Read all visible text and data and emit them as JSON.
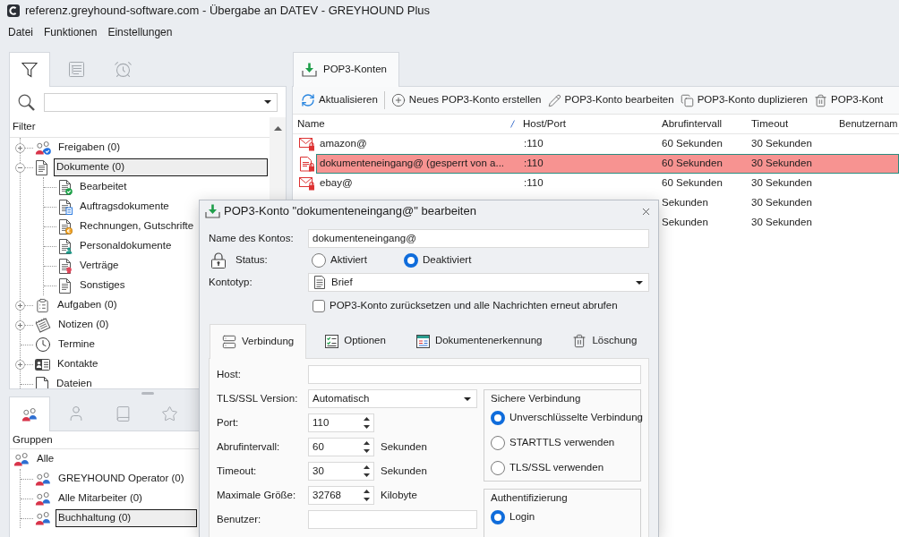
{
  "window": {
    "title": "referenz.greyhound-software.com - Übergabe an DATEV - GREYHOUND Plus"
  },
  "menu": [
    {
      "label": "Datei"
    },
    {
      "label": "Funktionen"
    },
    {
      "label": "Einstellungen"
    }
  ],
  "filter_panel": {
    "tabs": [
      {
        "selected": true
      },
      {
        "selected": false
      },
      {
        "selected": false
      }
    ],
    "header": "Filter",
    "tree": [
      {
        "label": "Freigaben (0)",
        "expandable": true,
        "expanded": false,
        "selected": false
      },
      {
        "label": "Dokumente (0)",
        "expandable": true,
        "expanded": true,
        "selected": true,
        "children": [
          {
            "label": "Bearbeitet",
            "selected": false
          },
          {
            "label": "Auftragsdokumente",
            "selected": false
          },
          {
            "label": "Rechnungen, Gutschrifte",
            "selected": false
          },
          {
            "label": "Personaldokumente",
            "selected": false
          },
          {
            "label": "Verträge",
            "selected": false
          },
          {
            "label": "Sonstiges",
            "selected": false
          }
        ]
      },
      {
        "label": "Aufgaben (0)",
        "expandable": true,
        "expanded": false,
        "selected": false
      },
      {
        "label": "Notizen (0)",
        "expandable": true,
        "expanded": false,
        "selected": false
      },
      {
        "label": "Termine",
        "expandable": false,
        "selected": false
      },
      {
        "label": "Kontakte",
        "expandable": true,
        "expanded": false,
        "selected": false
      },
      {
        "label": "Dateien",
        "expandable": false,
        "selected": false
      }
    ]
  },
  "groups_panel": {
    "tabs": [
      {
        "selected": true
      },
      {
        "selected": false
      },
      {
        "selected": false
      },
      {
        "selected": false
      }
    ],
    "header": "Gruppen",
    "tree": [
      {
        "label": "Alle",
        "selected": false,
        "children": [
          {
            "label": "GREYHOUND Operator (0)",
            "selected": false
          },
          {
            "label": "Alle Mitarbeiter (0)",
            "selected": false
          },
          {
            "label": "Buchhaltung (0)",
            "selected": true
          }
        ]
      }
    ]
  },
  "accounts": {
    "tabs": [
      {
        "label": "POP3-Konten",
        "selected": true
      }
    ],
    "toolbar": [
      {
        "label": "Aktualisieren"
      },
      {
        "label": "Neues POP3-Konto erstellen"
      },
      {
        "label": "POP3-Konto bearbeiten"
      },
      {
        "label": "POP3-Konto duplizieren"
      },
      {
        "label": "POP3-Kont"
      }
    ],
    "table": {
      "columns": [
        "Name",
        "Host/Port",
        "Abrufintervall",
        "Timeout",
        "Benutzernam"
      ],
      "rows": [
        {
          "kind": "mail",
          "name": "amazon@",
          "host_port": ":110",
          "interval": "60 Sekunden",
          "timeout": "30 Sekunden",
          "selected": false
        },
        {
          "kind": "letter",
          "name": "dokumenteneingang@ (gesperrt von a...",
          "host_port": ":110",
          "interval": "60 Sekunden",
          "timeout": "30 Sekunden",
          "selected": true
        },
        {
          "kind": "mail",
          "name": "ebay@",
          "host_port": ":110",
          "interval": "60 Sekunden",
          "timeout": "30 Sekunden",
          "selected": false
        },
        {
          "interval": "Sekunden",
          "timeout": "30 Sekunden",
          "selected": false
        },
        {
          "interval": "Sekunden",
          "timeout": "30 Sekunden",
          "selected": false
        }
      ]
    }
  },
  "dialog": {
    "title": "POP3-Konto \"dokumenteneingang@\" bearbeiten",
    "name": {
      "label": "Name des Kontos:",
      "value": "dokumenteneingang@"
    },
    "status": {
      "label": "Status:",
      "options": [
        {
          "label": "Aktiviert",
          "selected": false
        },
        {
          "label": "Deaktiviert",
          "selected": true
        }
      ]
    },
    "account_type": {
      "label": "Kontotyp:",
      "value": "Brief"
    },
    "reset": {
      "label": "POP3-Konto zurücksetzen und alle Nachrichten erneut abrufen",
      "checked": false
    },
    "tabs": [
      {
        "label": "Verbindung",
        "selected": true
      },
      {
        "label": "Optionen",
        "selected": false
      },
      {
        "label": "Dokumentenerkennung",
        "selected": false
      },
      {
        "label": "Löschung",
        "selected": false
      }
    ],
    "connection": {
      "host": {
        "label": "Host:"
      },
      "fields": [
        {
          "kind": "select",
          "label": "TLS/SSL Version:",
          "value": "Automatisch"
        },
        {
          "kind": "spin",
          "label": "Port:",
          "value": "110"
        },
        {
          "kind": "spin",
          "label": "Abrufintervall:",
          "value": "60",
          "unit": "Sekunden"
        },
        {
          "kind": "spin",
          "label": "Timeout:",
          "value": "30",
          "unit": "Sekunden"
        },
        {
          "kind": "spin",
          "label": "Maximale Größe:",
          "value": "32768",
          "unit": "Kilobyte"
        },
        {
          "kind": "text",
          "label": "Benutzer:"
        }
      ],
      "secure_connection": {
        "title": "Sichere Verbindung",
        "options": [
          {
            "label": "Unverschlüsselte Verbindung",
            "selected": true
          },
          {
            "label": "STARTTLS verwenden",
            "selected": false
          },
          {
            "label": "TLS/SSL verwenden",
            "selected": false
          }
        ]
      },
      "authentication": {
        "title": "Authentifizierung",
        "options": [
          {
            "label": "Login",
            "selected": true
          }
        ]
      }
    }
  }
}
